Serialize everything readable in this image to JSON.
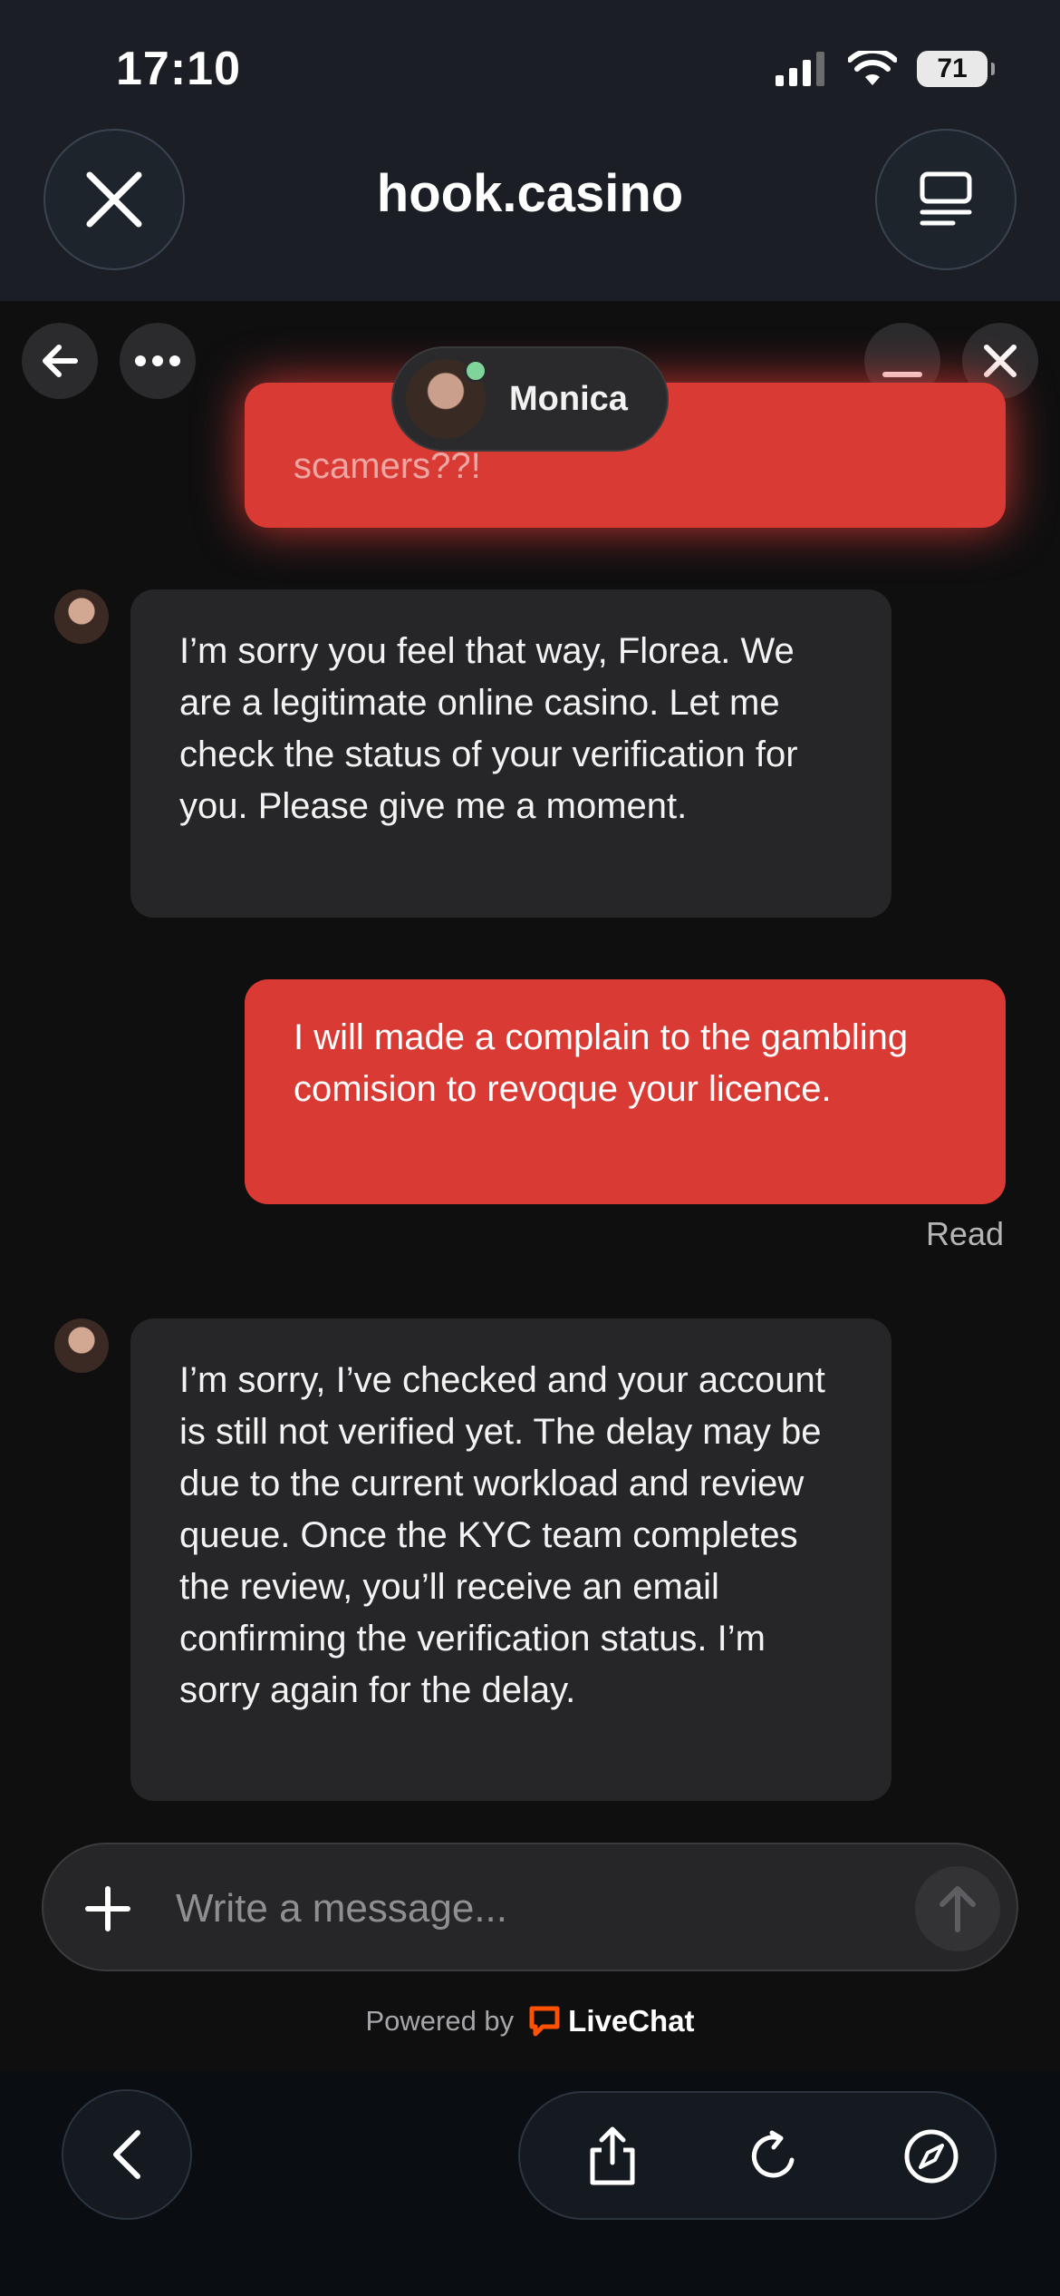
{
  "status_bar": {
    "time": "17:10",
    "battery": "71"
  },
  "browser": {
    "site": "hook.casino"
  },
  "chat": {
    "agent_name": "Monica",
    "messages": [
      {
        "from": "user",
        "text": "scamers??!"
      },
      {
        "from": "agent",
        "text": "I’m sorry you feel that way, Florea. We are a legitimate online casino. Let me check the status of your verification for you. Please give me a moment."
      },
      {
        "from": "user",
        "text": "I will made a complain to the gambling comision to revoque your licence."
      },
      {
        "from": "agent",
        "text": "I’m sorry, I’ve checked and your account is still not verified yet. The delay may be due to the current workload and review queue. Once the KYC team completes the review, you’ll receive an email confirming the verification status. I’m sorry again for the delay."
      }
    ],
    "read_label": "Read",
    "composer": {
      "placeholder": "Write a message..."
    },
    "powered_by": "Powered by",
    "brand": "LiveChat"
  },
  "colors": {
    "user_bubble": "#d93a34",
    "agent_bubble": "#262628",
    "online": "#7fd49a",
    "brand": "#ff5100"
  }
}
